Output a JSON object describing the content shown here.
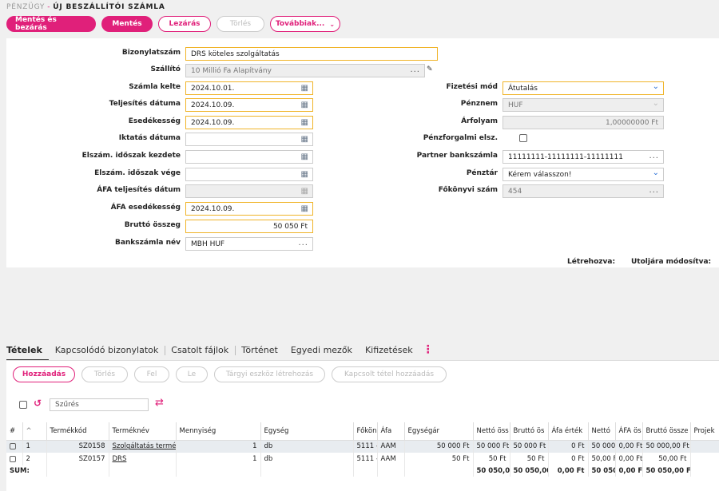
{
  "breadcrumb": {
    "module": "PÉNZÜGY",
    "separator": "-",
    "page": "ÚJ BESZÁLLÍTÓI SZÁMLA"
  },
  "toolbar": {
    "save_close": "Mentés és bezárás",
    "save": "Mentés",
    "close": "Lezárás",
    "delete": "Törlés",
    "more": "Továbbiak..."
  },
  "form": {
    "bizonylatszam": {
      "label": "Bizonylatszám",
      "value": "DRS köteles szolgáltatás"
    },
    "szallito": {
      "label": "Szállító",
      "value": "10 Millió Fa Alapítvány"
    },
    "szamla_kelte": {
      "label": "Számla kelte",
      "value": "2024.10.01."
    },
    "teljesites": {
      "label": "Teljesítés dátuma",
      "value": "2024.10.09."
    },
    "esedekesseg": {
      "label": "Esedékesség",
      "value": "2024.10.09."
    },
    "iktatas": {
      "label": "Iktatás dátuma",
      "value": ""
    },
    "idoszak_kezdete": {
      "label": "Elszám. időszak kezdete",
      "value": ""
    },
    "idoszak_vege": {
      "label": "Elszám. időszak vége",
      "value": ""
    },
    "afa_teljesites": {
      "label": "ÁFA teljesítés dátum",
      "value": ""
    },
    "afa_esedekesseg": {
      "label": "ÁFA esedékesség",
      "value": "2024.10.09."
    },
    "brutto": {
      "label": "Bruttó összeg",
      "value": "50 050 Ft"
    },
    "bankszamla_nev": {
      "label": "Bankszámla név",
      "value": "MBH HUF"
    },
    "fizetesi_mod": {
      "label": "Fizetési mód",
      "value": "Átutalás"
    },
    "penznem": {
      "label": "Pénznem",
      "value": "HUF"
    },
    "arfolyam": {
      "label": "Árfolyam",
      "value": "1,00000000 Ft"
    },
    "penzforgalmi": {
      "label": "Pénzforgalmi elsz."
    },
    "partner_bankszamla": {
      "label": "Partner bankszámla",
      "value": "11111111-11111111-11111111"
    },
    "penztar": {
      "label": "Pénztár",
      "value": "Kérem válasszon!"
    },
    "fokonyvi_szam": {
      "label": "Főkönyvi szám",
      "value": "454"
    },
    "letrehozva": "Létrehozva:",
    "utoljara": "Utoljára módosítva:"
  },
  "tabs": [
    "Tételek",
    "Kapcsolódó bizonylatok",
    "Csatolt fájlok",
    "Történet",
    "Egyedi mezők",
    "Kifizetések"
  ],
  "items_toolbar": {
    "add": "Hozzáadás",
    "delete": "Törlés",
    "up": "Fel",
    "down": "Le",
    "asset": "Tárgyi eszköz létrehozás",
    "linked": "Kapcsolt tétel hozzáadás"
  },
  "filter": {
    "placeholder": "Szűrés"
  },
  "table": {
    "columns": [
      "#",
      "Termékkód",
      "Terméknév",
      "Mennyiség",
      "Egység",
      "Főkön",
      "Áfa",
      "Egységár",
      "Nettó öss",
      "Bruttó ös",
      "Áfa érték",
      "Nettó",
      "ÁFA ös",
      "Bruttó össze",
      "Projek"
    ],
    "rows": [
      [
        "1",
        "SZ0158",
        "Szolgáltatás termék",
        "1",
        "db",
        "5111 -",
        "AAM",
        "50 000 Ft",
        "50 000 Ft",
        "50 000 Ft",
        "0 Ft",
        "50 000,",
        "0,00 Ft",
        "50 000,00 Ft",
        ""
      ],
      [
        "2",
        "SZ0157",
        "DRS",
        "1",
        "db",
        "5111 -",
        "AAM",
        "50 Ft",
        "50 Ft",
        "50 Ft",
        "0 Ft",
        "50,00 F",
        "0,00 Ft",
        "50,00 Ft",
        ""
      ]
    ],
    "sum": {
      "label": "SUM:",
      "netto": "50 050,00 F",
      "brutto": "50 050,00 F",
      "afa": "0,00 Ft",
      "netto2": "50 050,(",
      "afa2": "0,00 Ft",
      "brutto2": "50 050,00 Ft"
    }
  },
  "colors": {
    "accent": "#e0207a",
    "required_border": "#f0b429",
    "link_blue": "#2a6fd6"
  }
}
